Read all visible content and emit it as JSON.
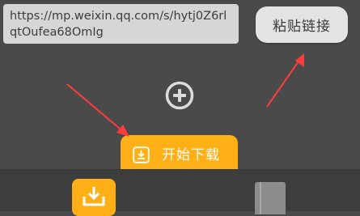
{
  "url_input": {
    "value": "https://mp.weixin.qq.com/s/hytj0Z6rlqtOufea68OmIg"
  },
  "paste_button": {
    "label": "粘贴链接"
  },
  "download_button": {
    "label": "开始下载",
    "icon": "download-icon"
  },
  "add_button": {
    "icon": "plus-circle-icon"
  },
  "bottom_nav": {
    "items": [
      {
        "icon": "download-tab-icon",
        "active": true
      },
      {
        "icon": "book-tab-icon",
        "active": false
      }
    ]
  },
  "annotation_arrows": {
    "color": "#ff3b3b"
  },
  "colors": {
    "background": "#4a4a4a",
    "accent": "#ffb017",
    "input_bg": "#d6d6d6",
    "button_bg": "#e3e3e3",
    "bottom_bar": "#3d3d3d"
  }
}
